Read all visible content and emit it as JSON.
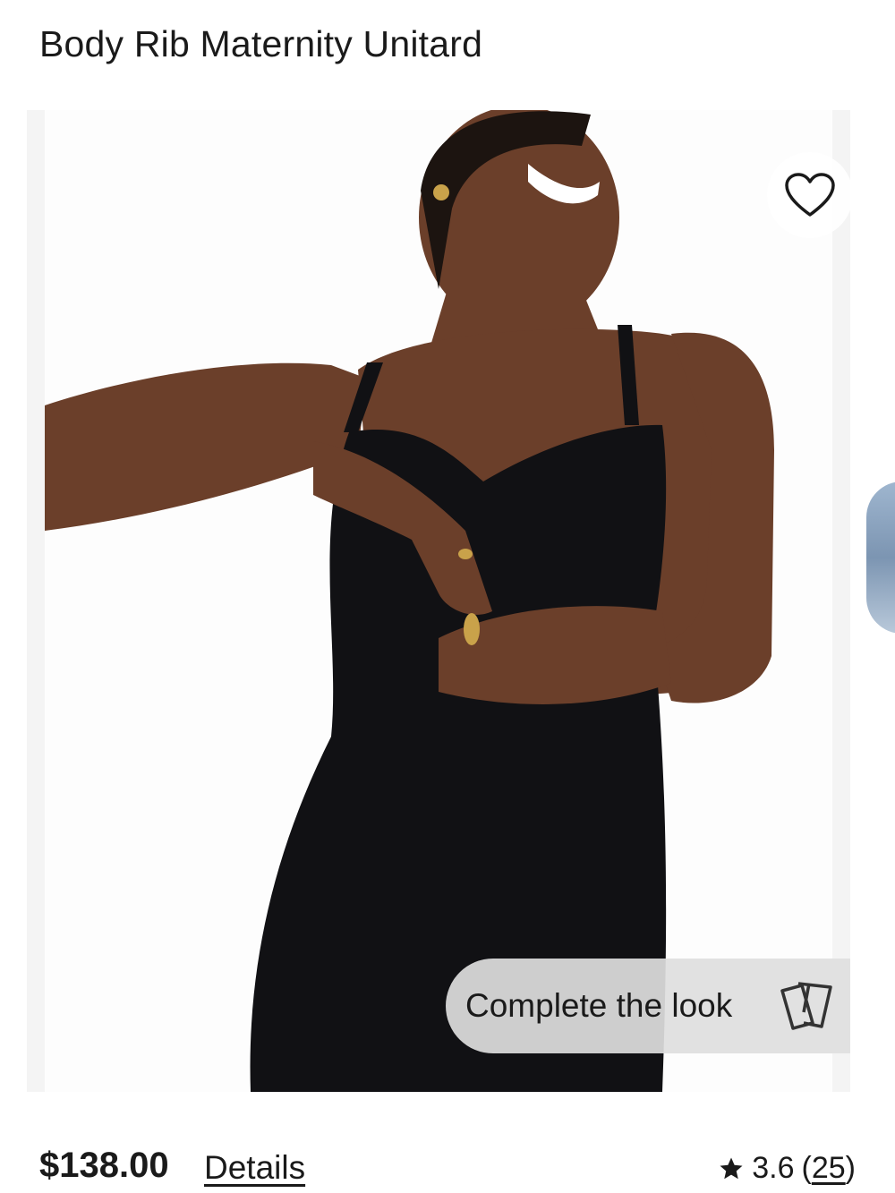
{
  "product": {
    "title": "Body Rib Maternity Unitard",
    "price": "$138.00",
    "details_label": "Details",
    "rating": "3.6",
    "rating_open": "(",
    "review_count": "25",
    "rating_close": ")"
  },
  "image": {
    "description_icon": "model-photo",
    "favorite_icon": "heart-outline-icon"
  },
  "complete_the_look": {
    "label": "Complete the look",
    "icon": "cards-icon"
  },
  "colors": {
    "text": "#1a1a1a",
    "garment": "#111114",
    "skin": "#6b3f2a",
    "button_bg": "#dedede"
  }
}
